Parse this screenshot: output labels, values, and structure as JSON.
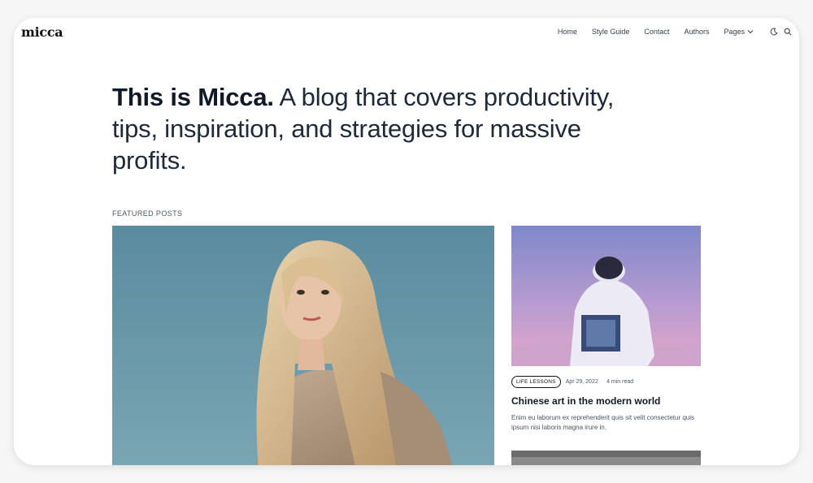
{
  "brand": {
    "logo": "micca"
  },
  "nav": {
    "items": [
      "Home",
      "Style Guide",
      "Contact",
      "Authors"
    ],
    "pages_label": "Pages",
    "icons": [
      "chevron-down-icon",
      "moon-icon",
      "search-icon"
    ]
  },
  "hero": {
    "bold": "This is Micca.",
    "rest": " A blog that covers productivity, tips, inspiration, and strategies for massive profits."
  },
  "featured": {
    "label": "FEATURED POSTS"
  },
  "posts": [
    {
      "tag": "LIFE LESSONS",
      "date": "Apr 29, 2022",
      "separator": "·",
      "read_time": "4 min read",
      "title": "Chinese art in the modern world",
      "excerpt": "Enim eu laborum ex reprehenderit quis sit velit consectetur quis ipsum nisi laboris magna irure in."
    }
  ],
  "colors": {
    "text": "#111827",
    "muted": "#4b5563",
    "background": "#ffffff"
  }
}
